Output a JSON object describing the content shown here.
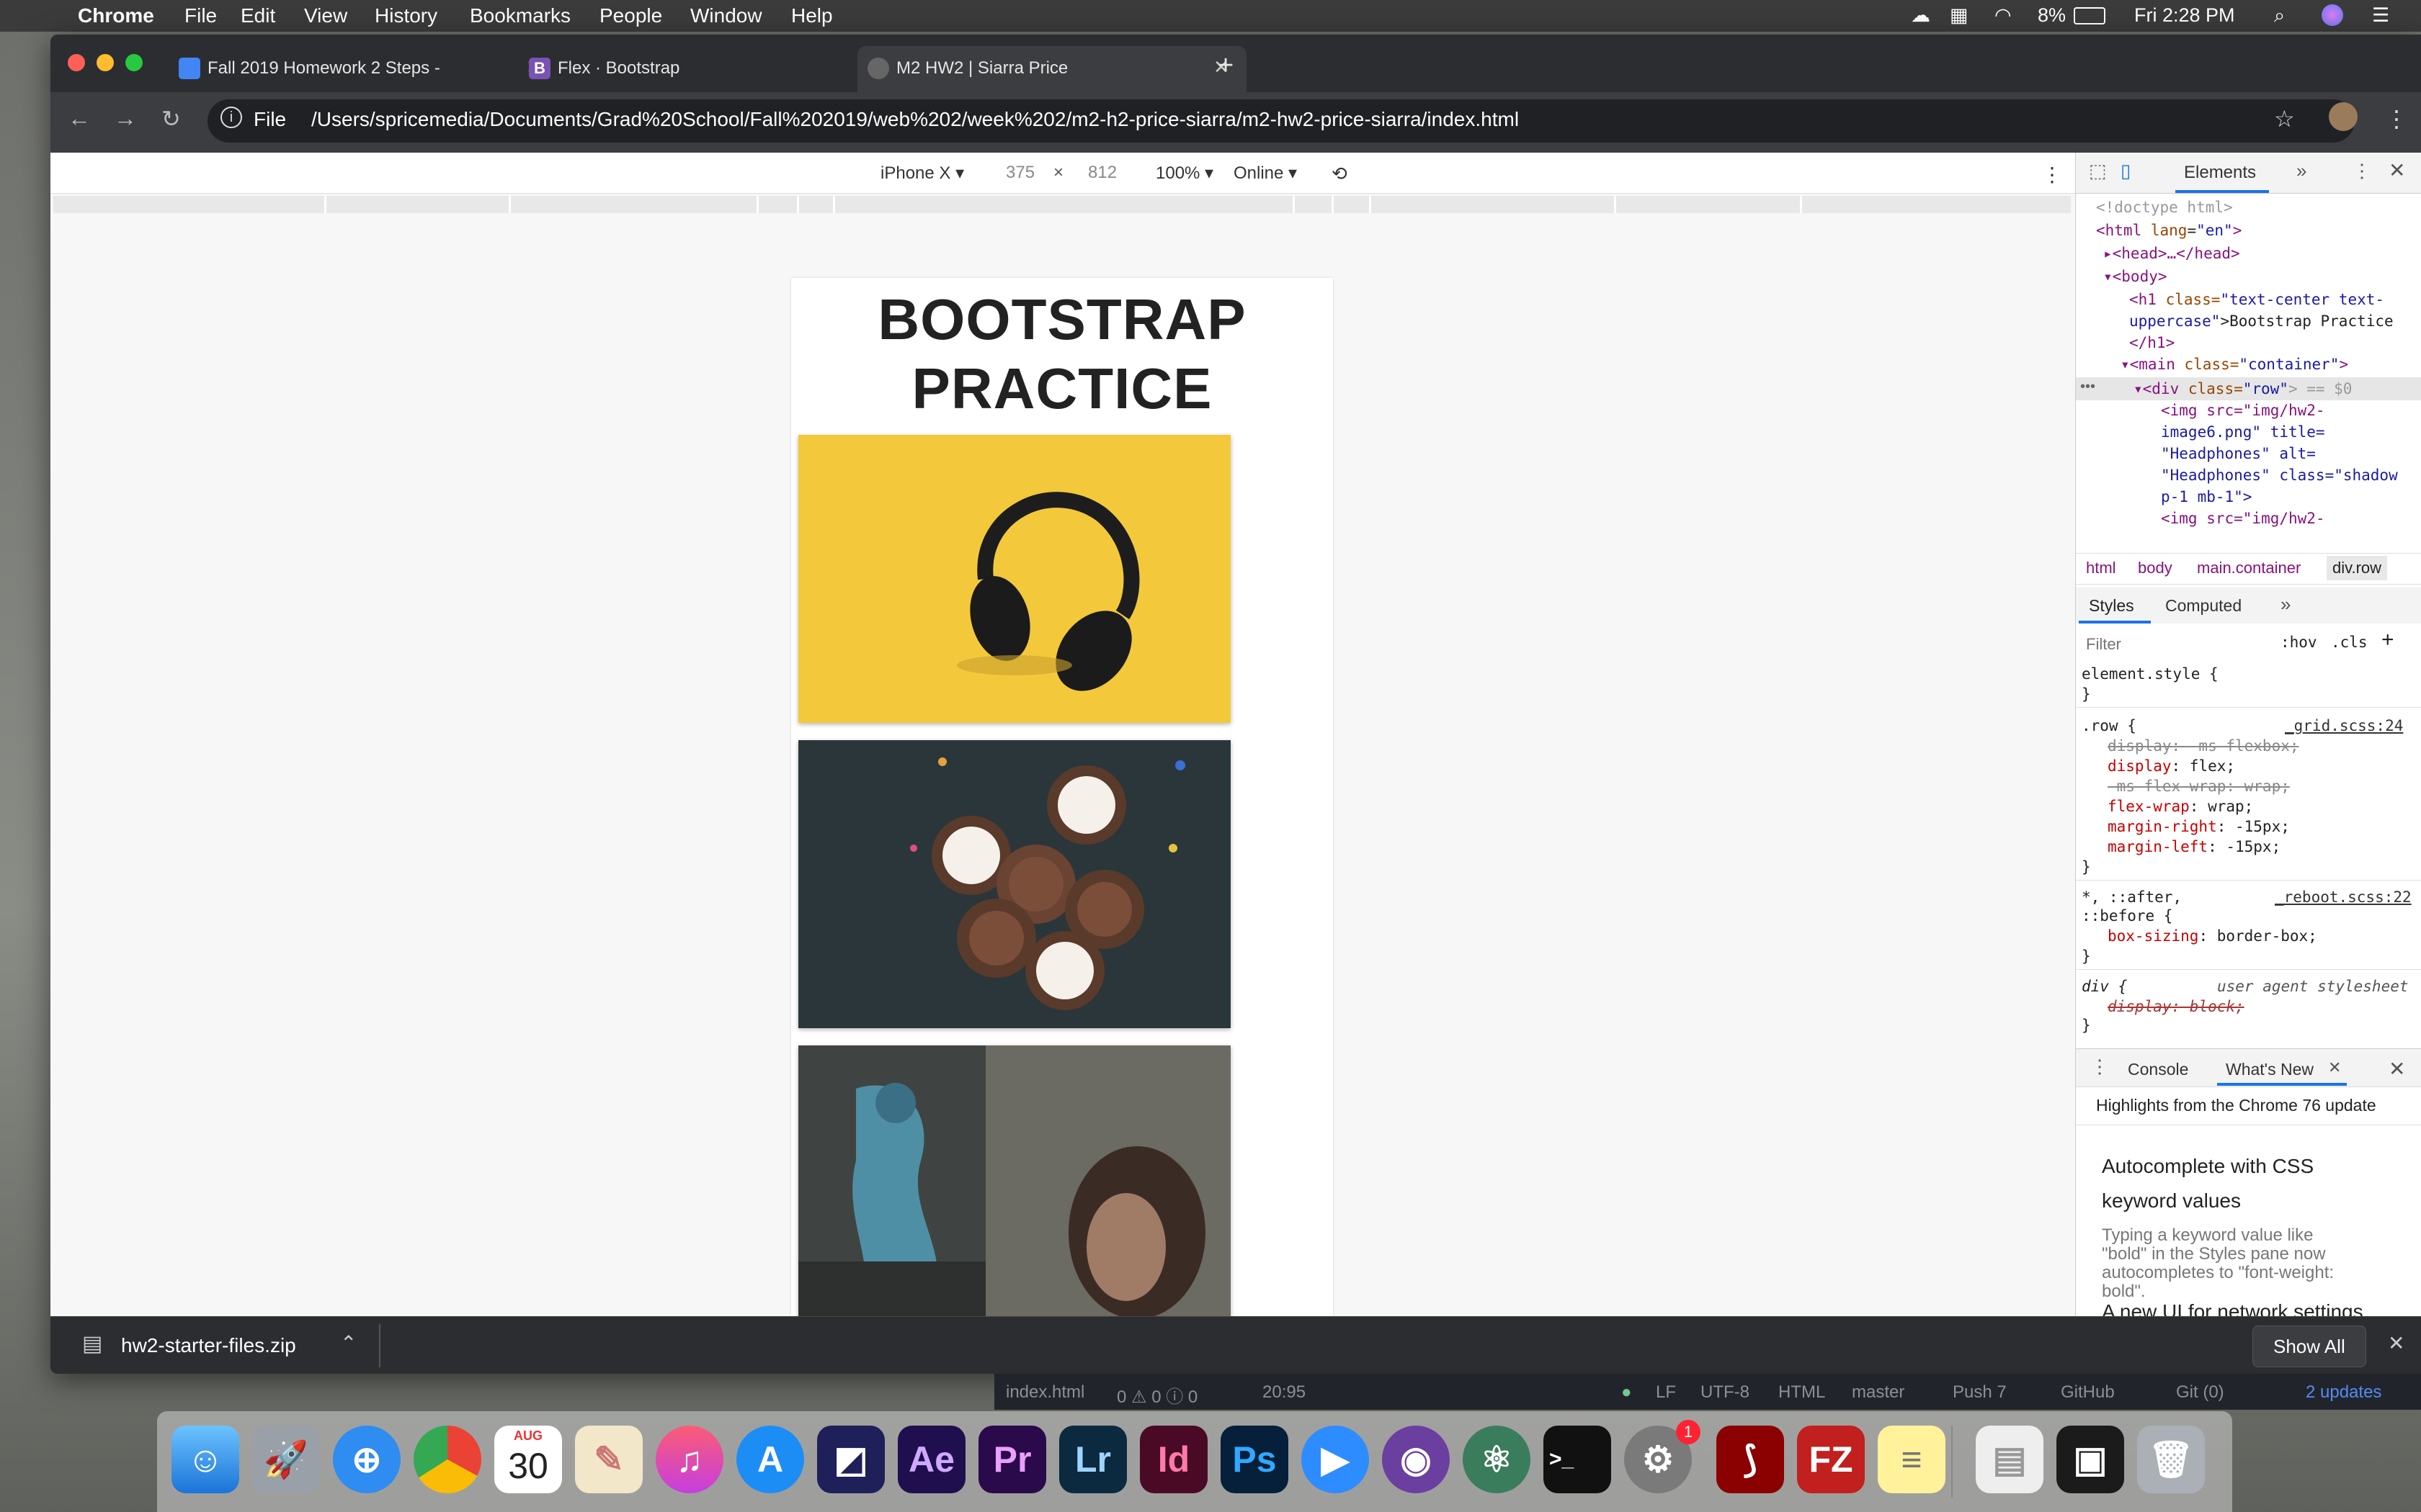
{
  "menubar": {
    "app": "Chrome",
    "items": [
      "File",
      "Edit",
      "View",
      "History",
      "Bookmarks",
      "People",
      "Window",
      "Help"
    ],
    "battery": "8%",
    "clock": "Fri 2:28 PM"
  },
  "tabs": [
    {
      "title": "Fall 2019 Homework 2 Steps -"
    },
    {
      "title": "Flex · Bootstrap"
    },
    {
      "title": "M2 HW2 | Siarra Price"
    }
  ],
  "address": {
    "scheme_label": "File",
    "url": "/Users/spricemedia/Documents/Grad%20School/Fall%202019/web%202/week%202/m2-h2-price-siarra/m2-hw2-price-siarra/index.html"
  },
  "device_toolbar": {
    "device": "iPhone X ▾",
    "width": "375",
    "times": "×",
    "height": "812",
    "zoom": "100% ▾",
    "network": "Online ▾"
  },
  "page": {
    "heading": "Bootstrap Practice"
  },
  "devtools": {
    "tabs": {
      "elements": "Elements",
      "more": "»"
    },
    "dom": {
      "doctype": "<!doctype html>",
      "html_open_tag": "<html",
      "html_attr": "lang",
      "html_val": "\"en\"",
      "head": "▸<head>…</head>",
      "body": "▾<body>",
      "h1_tag": "<h1",
      "h1_class_attr": "class=",
      "h1_class_val": "\"text-center text-",
      "h1_class_val2": "uppercase\"",
      "h1_text": ">Bootstrap Practice",
      "h1_close": "</h1>",
      "main_tag": "▾<main",
      "main_attr": "class=",
      "main_val": "\"container\"",
      "div_tag": "▾<div",
      "div_attr": "class=",
      "div_val": "\"row\"",
      "div_eq": "> == $0",
      "img_line1": "<img src=\"img/hw2-",
      "img_line2": "image6.png\" title=",
      "img_line3": "\"Headphones\" alt=",
      "img_line4": "\"Headphones\" class=\"shadow",
      "img_line5": "p-1 mb-1\">",
      "img_line6": "<img src=\"img/hw2-"
    },
    "breadcrumbs": [
      "html",
      "body",
      "main.container",
      "div.row"
    ],
    "styles_tabs": [
      "Styles",
      "Computed",
      "»"
    ],
    "filter_placeholder": "Filter",
    "hov": ":hov",
    "cls": ".cls",
    "plus": "+",
    "rules": {
      "element_style": "element.style {",
      "close": "}",
      "row_selector": ".row {",
      "row_source": "_grid.scss:24",
      "row_decl1": "display: -ms-flexbox;",
      "row_decl2_prop": "display",
      "row_decl2_val": ": flex;",
      "row_decl3": "-ms-flex-wrap: wrap;",
      "row_decl4_prop": "flex-wrap",
      "row_decl4_val": ": wrap;",
      "row_decl5_prop": "margin-right",
      "row_decl5_val": ": -15px;",
      "row_decl6_prop": "margin-left",
      "row_decl6_val": ": -15px;",
      "univ_selector": "*, ::after,",
      "univ_selector2": "::before {",
      "univ_source": "_reboot.scss:22",
      "univ_decl_prop": "box-sizing",
      "univ_decl_val": ": border-box;",
      "div_selector": "div {",
      "div_source": "user agent stylesheet",
      "div_decl": "display: block;"
    },
    "drawer": {
      "console": "Console",
      "whats_new": "What's New",
      "highlights": "Highlights from the Chrome 76 update",
      "item1_title_a": "Autocomplete with CSS",
      "item1_title_b": "keyword values",
      "item1_desc_a": "Typing a keyword value like",
      "item1_desc_b": "\"bold\" in the Styles pane now",
      "item1_desc_c": "autocompletes to \"font-weight:",
      "item1_desc_d": "bold\".",
      "item2_title": "A new UI for network settings"
    }
  },
  "download_shelf": {
    "filename": "hw2-starter-files.zip",
    "show_all": "Show All"
  },
  "atom_status": {
    "file": "index.html",
    "counts": "0 ⚠ 0 ⓘ 0",
    "cursor": "20:95",
    "line_ending": "LF",
    "encoding": "UTF-8",
    "grammar": "HTML",
    "branch": "master",
    "push": "Push 7",
    "github": "GitHub",
    "git": "Git (0)",
    "updates": "2 updates"
  },
  "dock": {
    "calendar_month": "AUG",
    "calendar_day": "30",
    "ae": "Ae",
    "pr": "Pr",
    "lr": "Lr",
    "id": "Id",
    "ps": "Ps",
    "badge": "1"
  },
  "colors": {
    "chrome_dark": "#2b2d30",
    "devtools_accent": "#1a73e8",
    "headphones_bg": "#f2c83a"
  }
}
